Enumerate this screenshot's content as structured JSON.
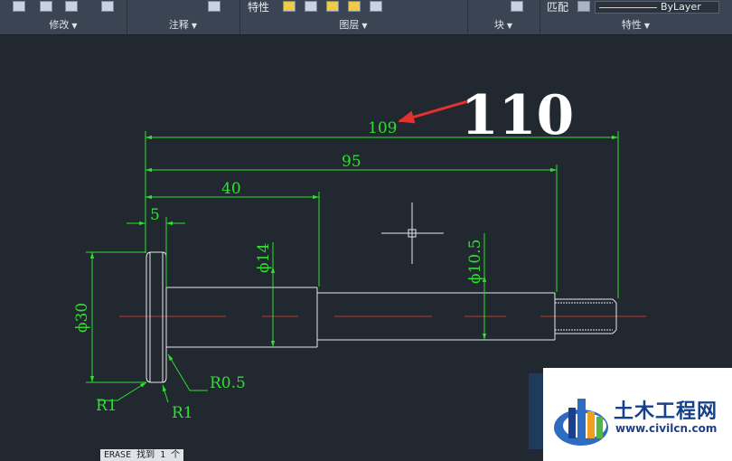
{
  "ribbon": {
    "groups": [
      {
        "label": "修改"
      },
      {
        "label": "注释"
      },
      {
        "label": "图层"
      },
      {
        "label": "块"
      },
      {
        "label": "特性"
      }
    ],
    "tekixing_button": "特性",
    "pipei_button": "匹配",
    "layer_select": "ByLayer"
  },
  "drawing": {
    "dim_overall": "109",
    "dim_95": "95",
    "dim_40": "40",
    "dim_5": "5",
    "dia_30": "ϕ30",
    "dia_14": "ϕ14",
    "dia_10_5": "ϕ10.5",
    "radius_05": "R0.5",
    "radius_1a": "R1",
    "radius_1b": "R1",
    "annotation_handwritten": "110"
  },
  "command_line": {
    "text": "ERASE 找到 1 个"
  },
  "watermark": {
    "title": "土木工程网",
    "url": "www.civilcn.com"
  },
  "colors": {
    "dimension": "#2fe02f",
    "geometry": "#e8e8e8",
    "centerline": "#c0392b",
    "arrow": "#e53030",
    "background": "#212830"
  }
}
